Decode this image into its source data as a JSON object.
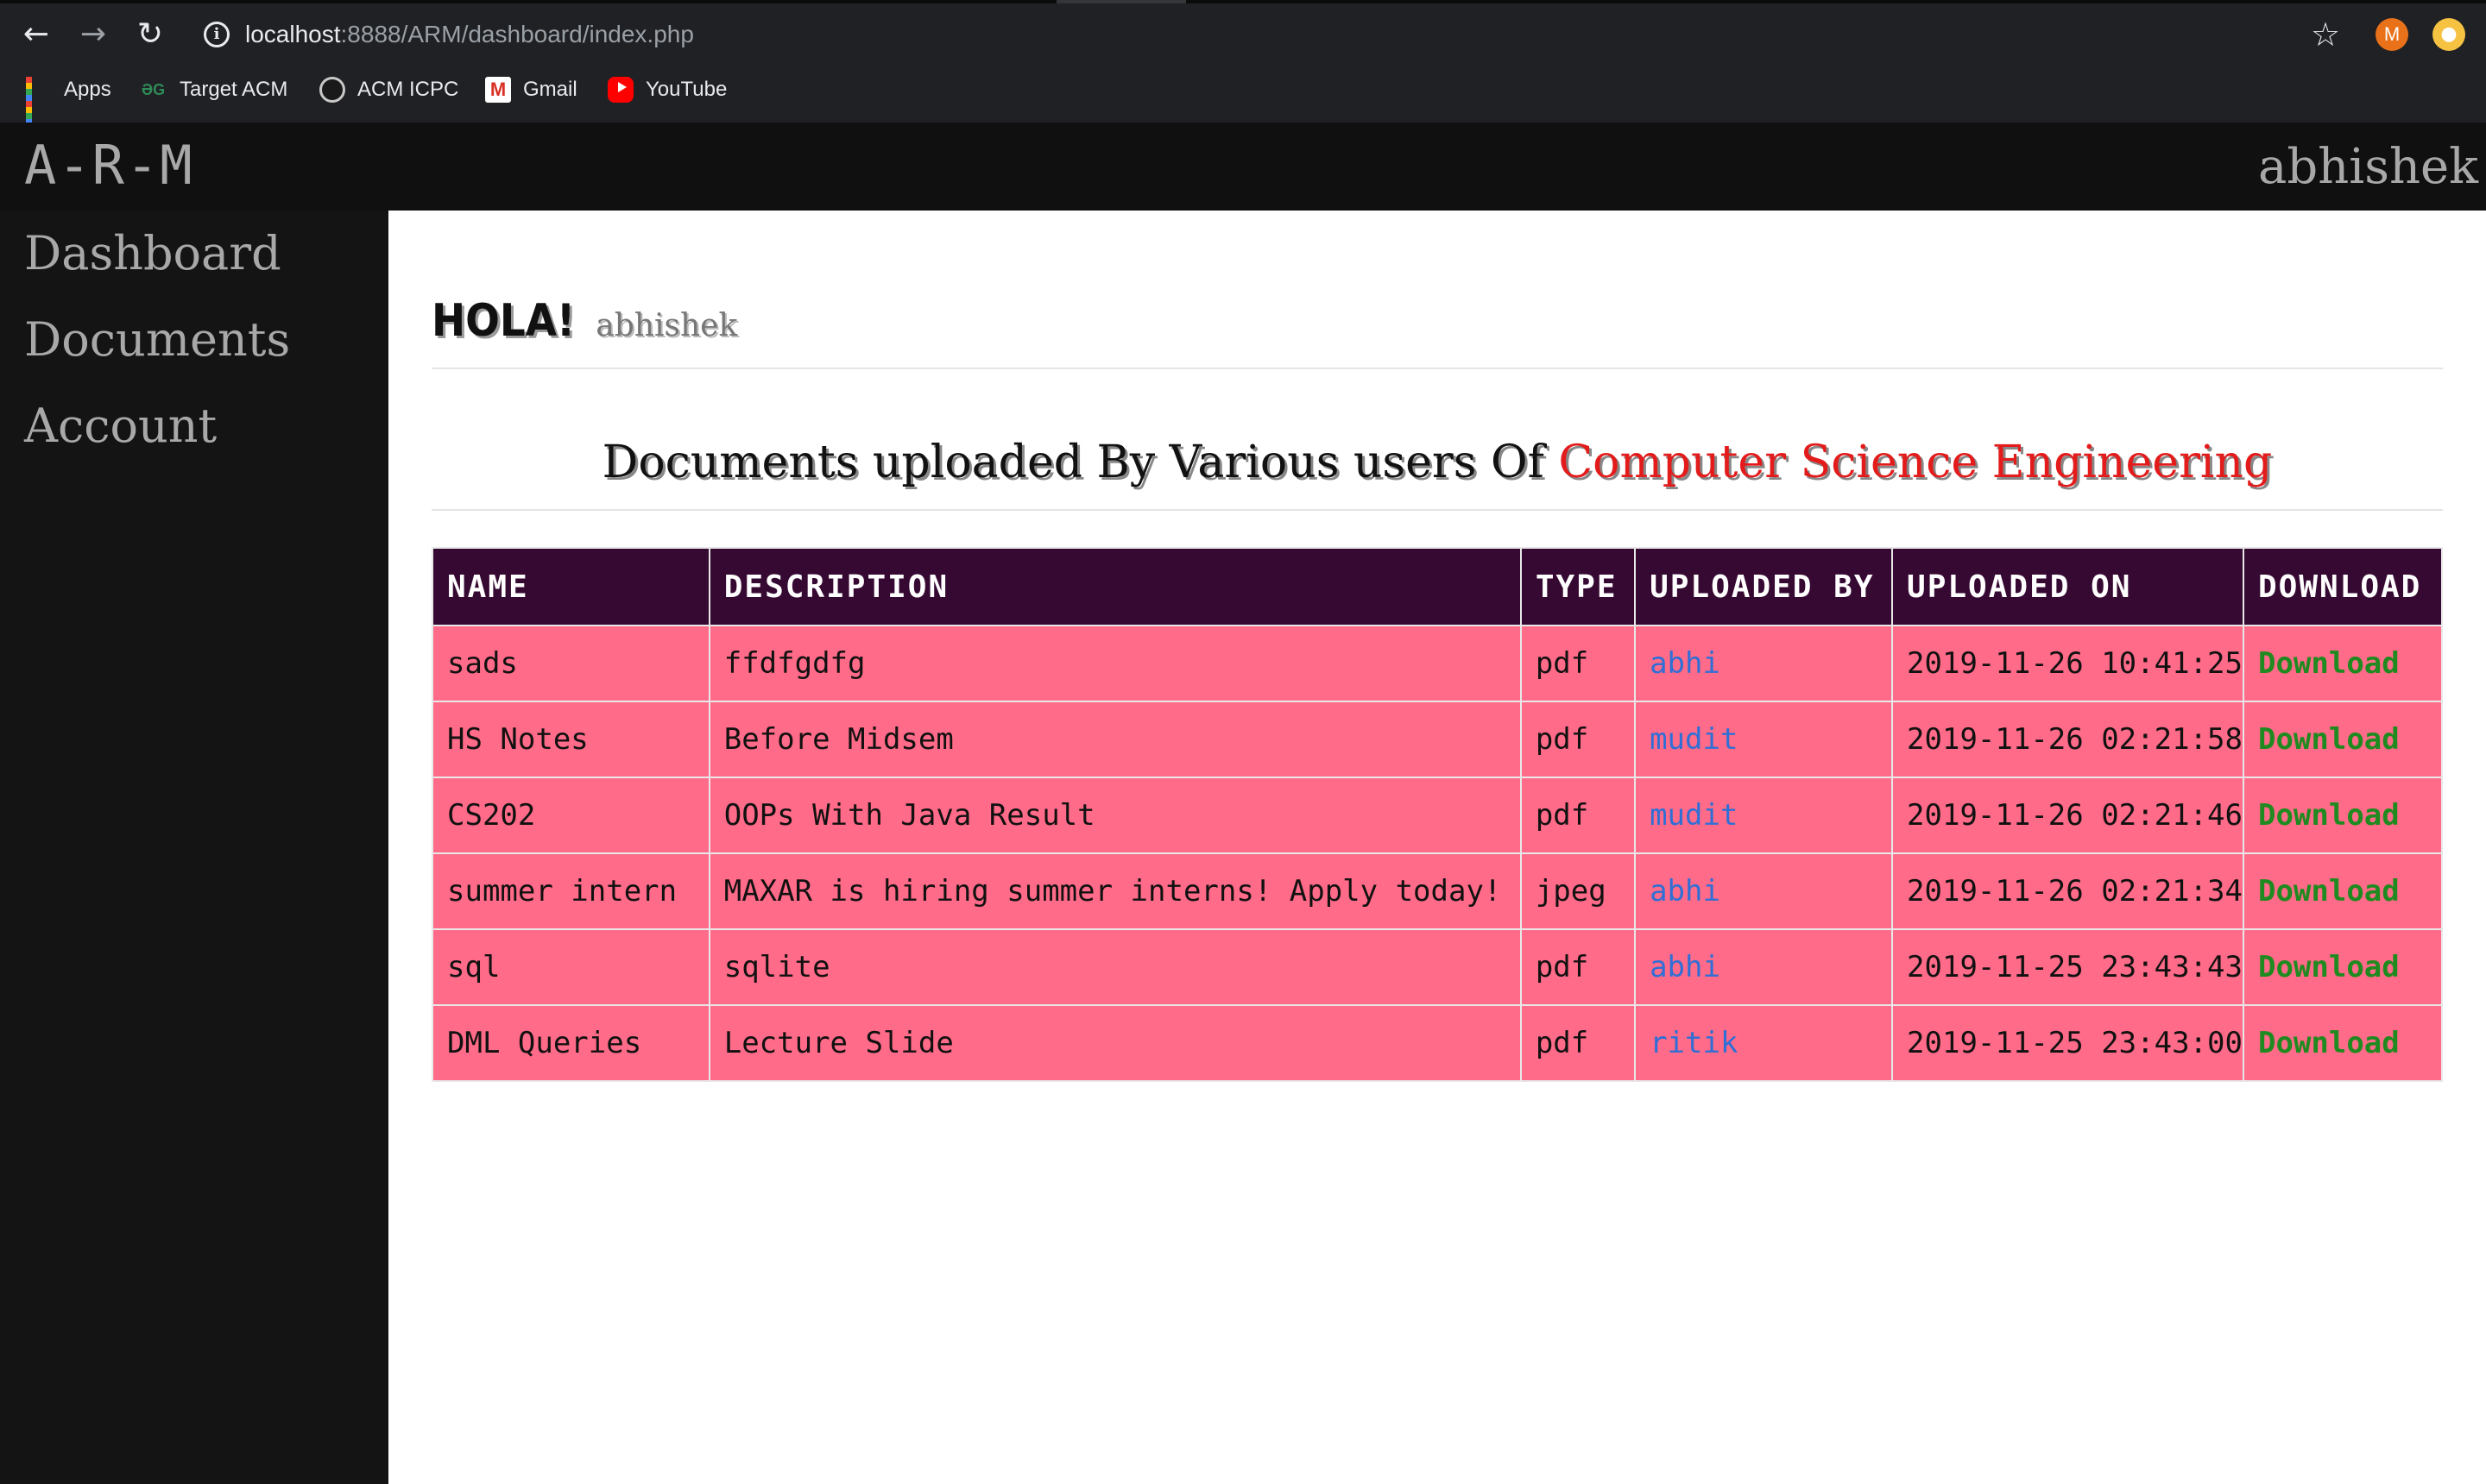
{
  "browser": {
    "url_host": "localhost",
    "url_path": ":8888/ARM/dashboard/index.php",
    "profile_initial": "M",
    "bookmarks": [
      "Apps",
      "Target ACM",
      "ACM ICPC",
      "Gmail",
      "YouTube"
    ]
  },
  "navbar": {
    "brand": "A-R-M",
    "user": "abhishek"
  },
  "sidebar": {
    "items": [
      "Dashboard",
      "Documents",
      "Account"
    ]
  },
  "main": {
    "greeting": "HOLA!",
    "username": "abhishek",
    "heading_prefix": "Documents uploaded By Various users Of",
    "heading_dept": "Computer Science Engineering",
    "columns": [
      "NAME",
      "DESCRIPTION",
      "TYPE",
      "UPLOADED BY",
      "UPLOADED ON",
      "DOWNLOAD"
    ],
    "rows": [
      {
        "name": "sads",
        "description": "ffdfgdfg",
        "type": "pdf",
        "uploaded_by": "abhi",
        "uploaded_on": "2019-11-26 10:41:25",
        "download": "Download"
      },
      {
        "name": "HS Notes",
        "description": "Before Midsem",
        "type": "pdf",
        "uploaded_by": "mudit",
        "uploaded_on": "2019-11-26 02:21:58",
        "download": "Download"
      },
      {
        "name": "CS202",
        "description": "OOPs With Java Result",
        "type": "pdf",
        "uploaded_by": "mudit",
        "uploaded_on": "2019-11-26 02:21:46",
        "download": "Download"
      },
      {
        "name": "summer intern",
        "description": "MAXAR is hiring summer interns! Apply today!",
        "type": "jpeg",
        "uploaded_by": "abhi",
        "uploaded_on": "2019-11-26 02:21:34",
        "download": "Download"
      },
      {
        "name": "sql",
        "description": "sqlite",
        "type": "pdf",
        "uploaded_by": "abhi",
        "uploaded_on": "2019-11-25 23:43:43",
        "download": "Download"
      },
      {
        "name": "DML Queries",
        "description": "Lecture Slide",
        "type": "pdf",
        "uploaded_by": "ritik",
        "uploaded_on": "2019-11-25 23:43:00",
        "download": "Download"
      }
    ]
  }
}
